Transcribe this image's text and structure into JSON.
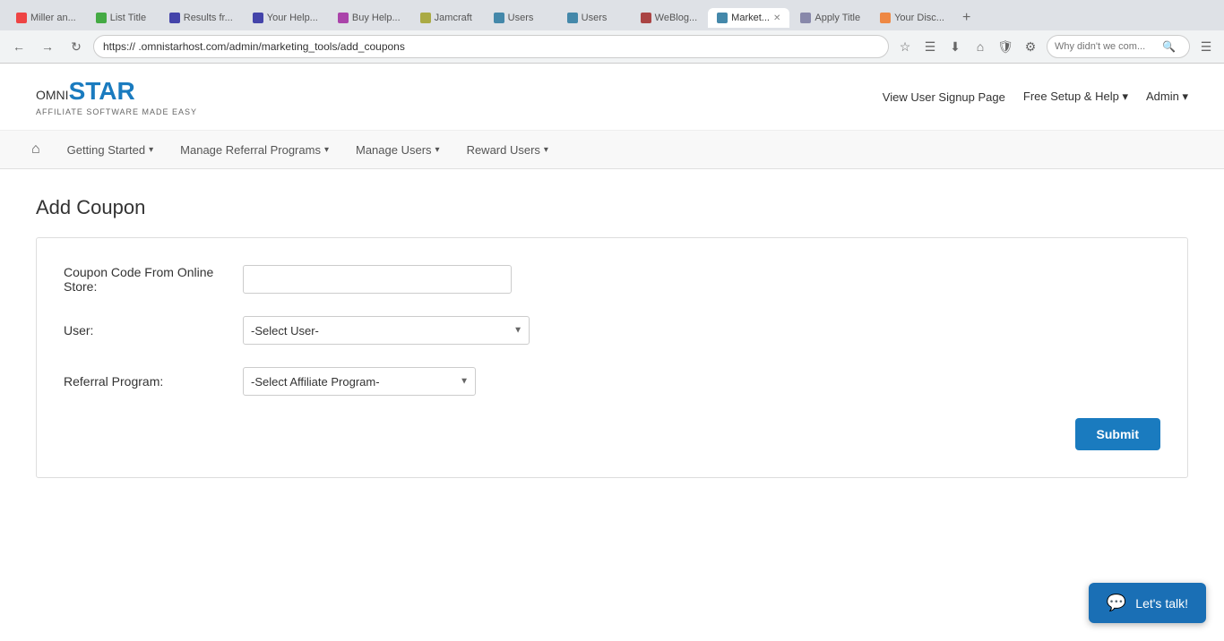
{
  "browser": {
    "tabs": [
      {
        "label": "Miller an...",
        "favicon_color": "#e44",
        "active": false
      },
      {
        "label": "List Title",
        "favicon_color": "#4a4",
        "active": false
      },
      {
        "label": "Results fr...",
        "favicon_color": "#44a",
        "active": false
      },
      {
        "label": "Your Help...",
        "favicon_color": "#44a",
        "active": false
      },
      {
        "label": "Buy Help...",
        "favicon_color": "#a4a",
        "active": false
      },
      {
        "label": "Jamcraft",
        "favicon_color": "#aa4",
        "active": false
      },
      {
        "label": "Users",
        "favicon_color": "#48a",
        "active": false
      },
      {
        "label": "Users",
        "favicon_color": "#48a",
        "active": false
      },
      {
        "label": "WeBlog...",
        "favicon_color": "#a44",
        "active": false
      },
      {
        "label": "Market...",
        "favicon_color": "#48a",
        "active": true
      },
      {
        "label": "Apply Title",
        "favicon_color": "#88a",
        "active": false
      },
      {
        "label": "Your Disc...",
        "favicon_color": "#e84",
        "active": false
      }
    ],
    "url": "https://                    .omnistarhost.com/admin/marketing_tools/add_coupons",
    "search_placeholder": "Why didn't we com..."
  },
  "header": {
    "logo_omni": "OMNI",
    "logo_star": "STAR",
    "logo_tagline": "AFFILIATE SOFTWARE MADE EASY",
    "nav_items": [
      {
        "label": "View User Signup Page"
      },
      {
        "label": "Free Setup & Help",
        "has_dropdown": true
      },
      {
        "label": "Admin",
        "has_dropdown": true
      }
    ]
  },
  "nav": {
    "home_icon": "⌂",
    "items": [
      {
        "label": "Getting Started",
        "has_dropdown": true
      },
      {
        "label": "Manage Referral Programs",
        "has_dropdown": true
      },
      {
        "label": "Manage Users",
        "has_dropdown": true
      },
      {
        "label": "Reward Users",
        "has_dropdown": true
      }
    ]
  },
  "page": {
    "title": "Add Coupon",
    "form": {
      "coupon_code_label": "Coupon Code From Online Store:",
      "coupon_code_placeholder": "",
      "user_label": "User:",
      "user_select_default": "-Select User-",
      "referral_program_label": "Referral Program:",
      "referral_program_select_default": "-Select Affiliate Program-",
      "submit_label": "Submit"
    }
  },
  "chat": {
    "label": "Let's talk!",
    "icon": "💬"
  }
}
